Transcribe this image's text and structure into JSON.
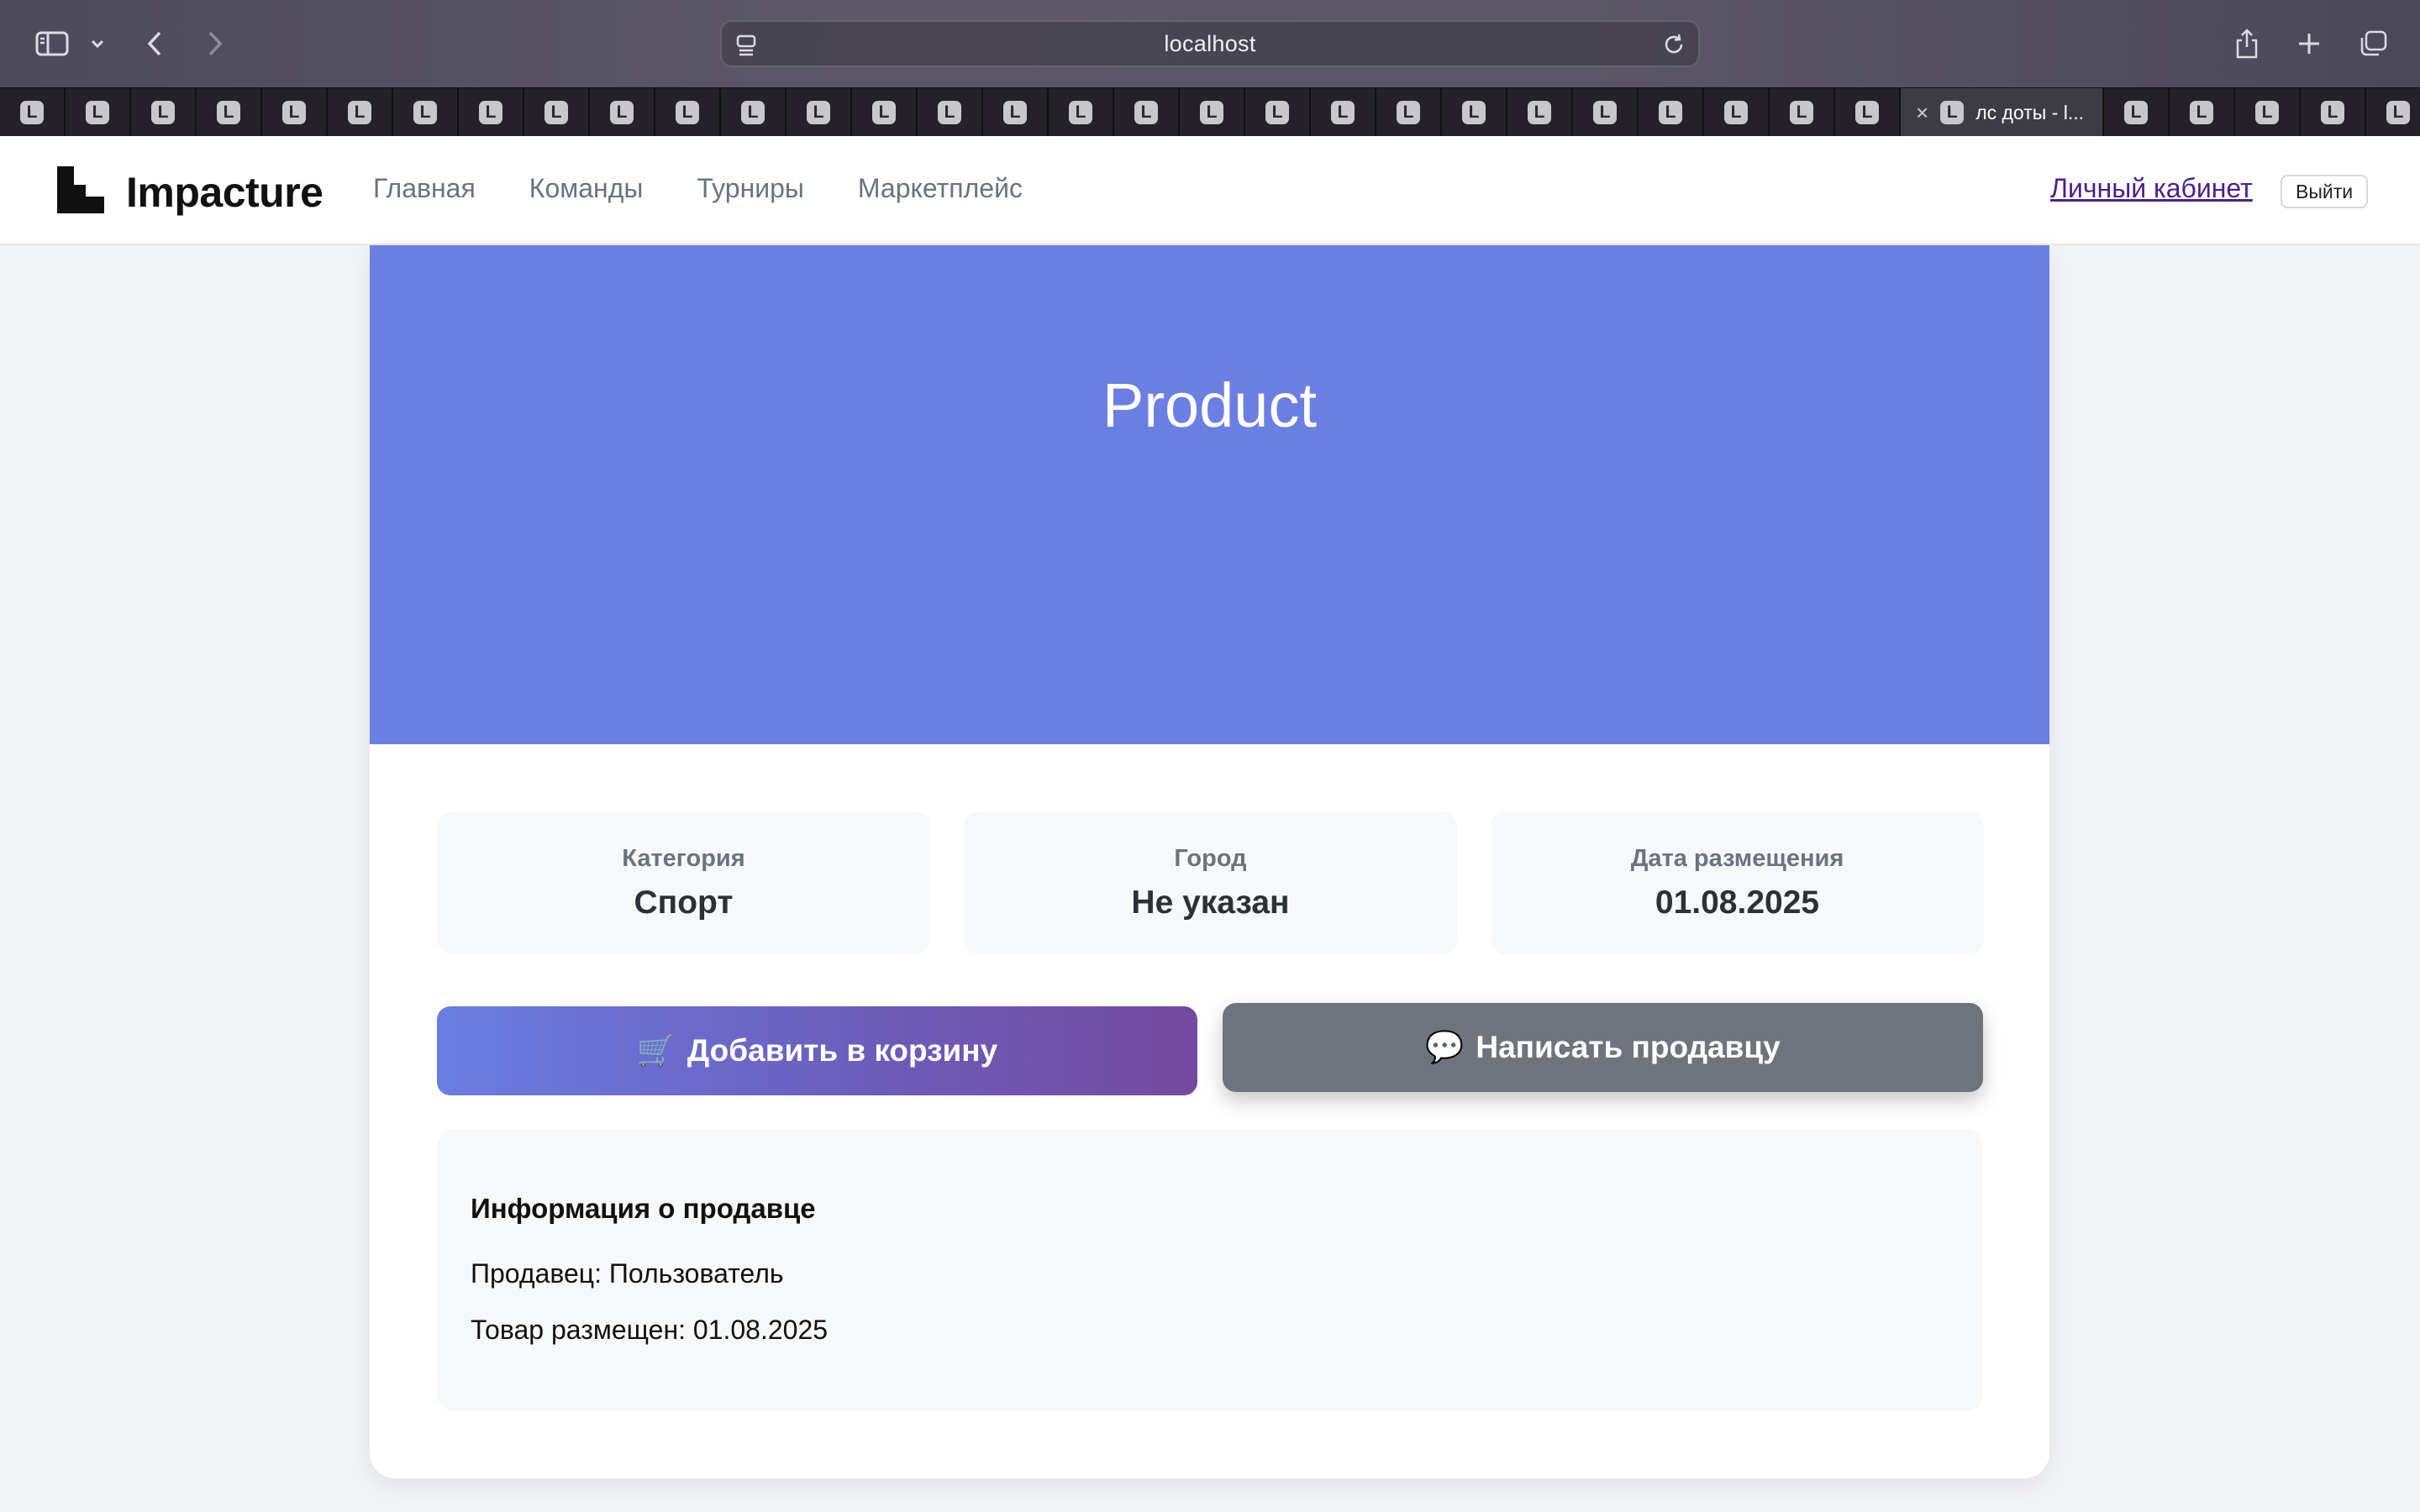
{
  "browser": {
    "address": "localhost",
    "tab_favicon_letter": "L",
    "active_tab_title": "лс доты - l...",
    "tabs_before_active": 29,
    "tabs_after_active": 5
  },
  "header": {
    "logo_text": "Impacture",
    "nav": [
      "Главная",
      "Команды",
      "Турниры",
      "Маркетплейс"
    ],
    "cabinet_link": "Личный кабинет",
    "logout_label": "Выйти"
  },
  "product": {
    "title": "Product",
    "hero_color": "#6b7fe3",
    "stats": [
      {
        "label": "Категория",
        "value": "Спорт"
      },
      {
        "label": "Город",
        "value": "Не указан"
      },
      {
        "label": "Дата размещения",
        "value": "01.08.2025"
      }
    ],
    "cart_button": {
      "icon": "🛒",
      "label": "Добавить в корзину"
    },
    "message_button": {
      "icon": "💬",
      "label": "Написать продавцу"
    }
  },
  "seller": {
    "title": "Информация о продавце",
    "seller_line": "Продавец: Пользователь",
    "placed_line": "Товар размещен: 01.08.2025"
  }
}
